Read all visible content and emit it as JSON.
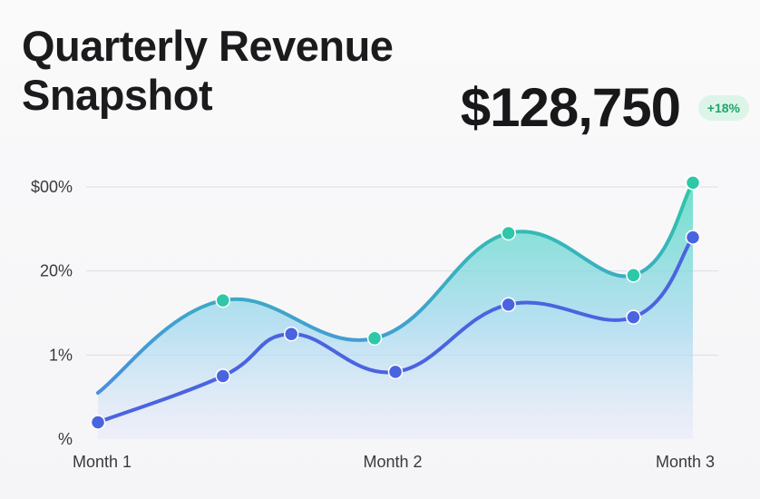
{
  "header": {
    "title": "Quarterly Revenue Snapshot",
    "headline_value": "$128,750",
    "change_badge": "+18%"
  },
  "colors": {
    "series_top": "#2ec7a8",
    "series_bottom": "#4a64e0",
    "badge_bg": "#ddf5e9",
    "badge_text": "#1fa56c"
  },
  "chart_data": {
    "type": "area",
    "title": "",
    "xlabel": "",
    "ylabel": "",
    "x_tick_labels": [
      "Month 1",
      "Month 2",
      "Month 3"
    ],
    "y_tick_labels": [
      "$00%",
      "20%",
      "1%",
      "%"
    ],
    "ylim": [
      0,
      3
    ],
    "xlim": [
      0,
      2
    ],
    "grid": true,
    "legend": "none",
    "series": [
      {
        "x": [
          0,
          0.42,
          0.93,
          1.38,
          1.8,
          2.0
        ],
        "values": [
          0.55,
          1.65,
          1.2,
          2.45,
          1.95,
          3.05
        ]
      },
      {
        "x": [
          0,
          0.42,
          0.65,
          1.0,
          1.38,
          1.8,
          2.0
        ],
        "values": [
          0.2,
          0.75,
          1.25,
          0.8,
          1.6,
          1.45,
          2.4
        ]
      }
    ]
  }
}
